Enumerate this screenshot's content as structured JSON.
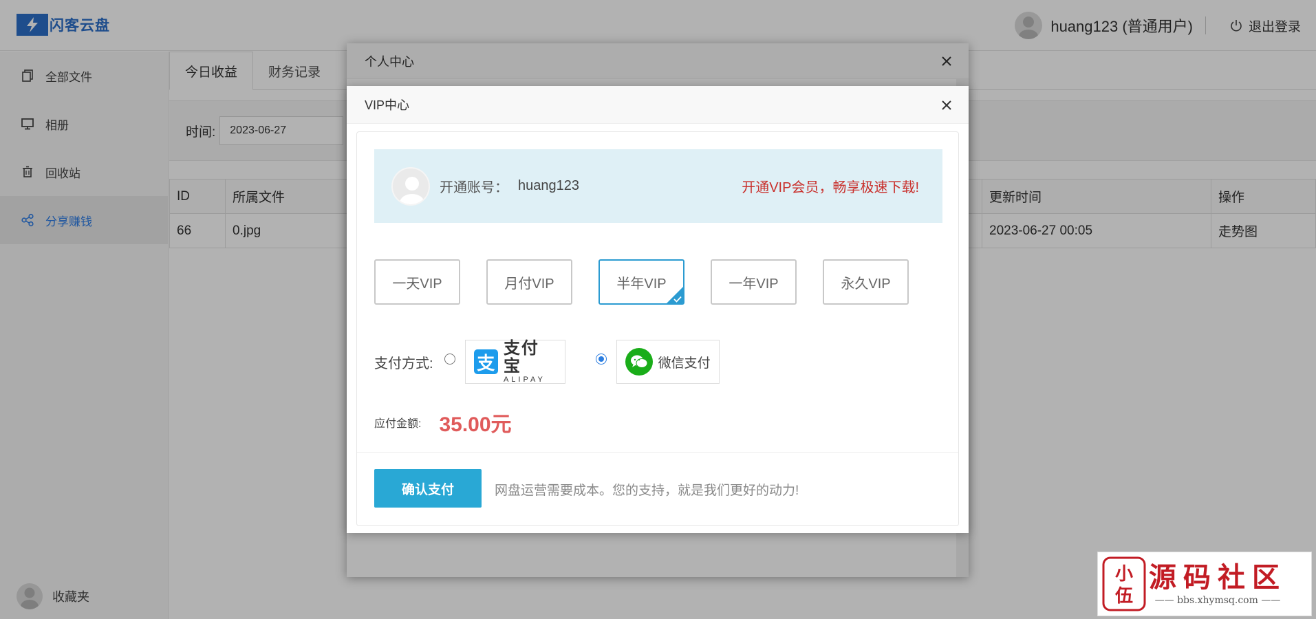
{
  "app": {
    "logo_text": "闪客云盘",
    "user_display": "huang123 (普通用户)",
    "logout_label": "退出登录"
  },
  "sidebar": {
    "items": [
      {
        "label": "全部文件",
        "icon": "copy-icon"
      },
      {
        "label": "相册",
        "icon": "monitor-icon"
      },
      {
        "label": "回收站",
        "icon": "trash-icon"
      },
      {
        "label": "分享赚钱",
        "icon": "share-icon",
        "active": true
      }
    ],
    "favorites_label": "收藏夹"
  },
  "main": {
    "tabs": [
      {
        "label": "今日收益",
        "active": true
      },
      {
        "label": "财务记录",
        "active": false
      }
    ],
    "filter_label": "时间:",
    "filter_value": "2023-06-27",
    "table": {
      "headers": {
        "id": "ID",
        "file": "所属文件",
        "updated": "更新时间",
        "action": "操作"
      },
      "rows": [
        {
          "id": "66",
          "file": "0.jpg",
          "updated": "2023-06-27 00:05",
          "action": "走势图"
        }
      ]
    }
  },
  "modal_personal": {
    "title": "个人中心"
  },
  "modal_vip": {
    "title": "VIP中心",
    "account_label": "开通账号：",
    "account_name": "huang123",
    "promo": "开通VIP会员，畅享极速下载!",
    "plans": [
      {
        "label": "一天VIP",
        "selected": false
      },
      {
        "label": "月付VIP",
        "selected": false
      },
      {
        "label": "半年VIP",
        "selected": true
      },
      {
        "label": "一年VIP",
        "selected": false
      },
      {
        "label": "永久VIP",
        "selected": false
      }
    ],
    "payment_label": "支付方式:",
    "alipay": {
      "text_cn": "支付宝",
      "text_en": "ALIPAY",
      "selected": false
    },
    "wechat": {
      "text": "微信支付",
      "selected": true
    },
    "amount_label": "应付金额:",
    "amount_value": "35.00元",
    "confirm_label": "确认支付",
    "note": "网盘运营需要成本。您的支持，就是我们更好的动力!"
  },
  "watermark": {
    "text_cn": "源码社区",
    "url": "—— bbs.xhymsq.com ——"
  },
  "colors": {
    "accent": "#29a8d5",
    "active_nav": "#2c7be5",
    "price": "#e05b5b",
    "promo": "#c9302c",
    "wechat": "#1aad19",
    "alipay": "#1d9cec"
  }
}
